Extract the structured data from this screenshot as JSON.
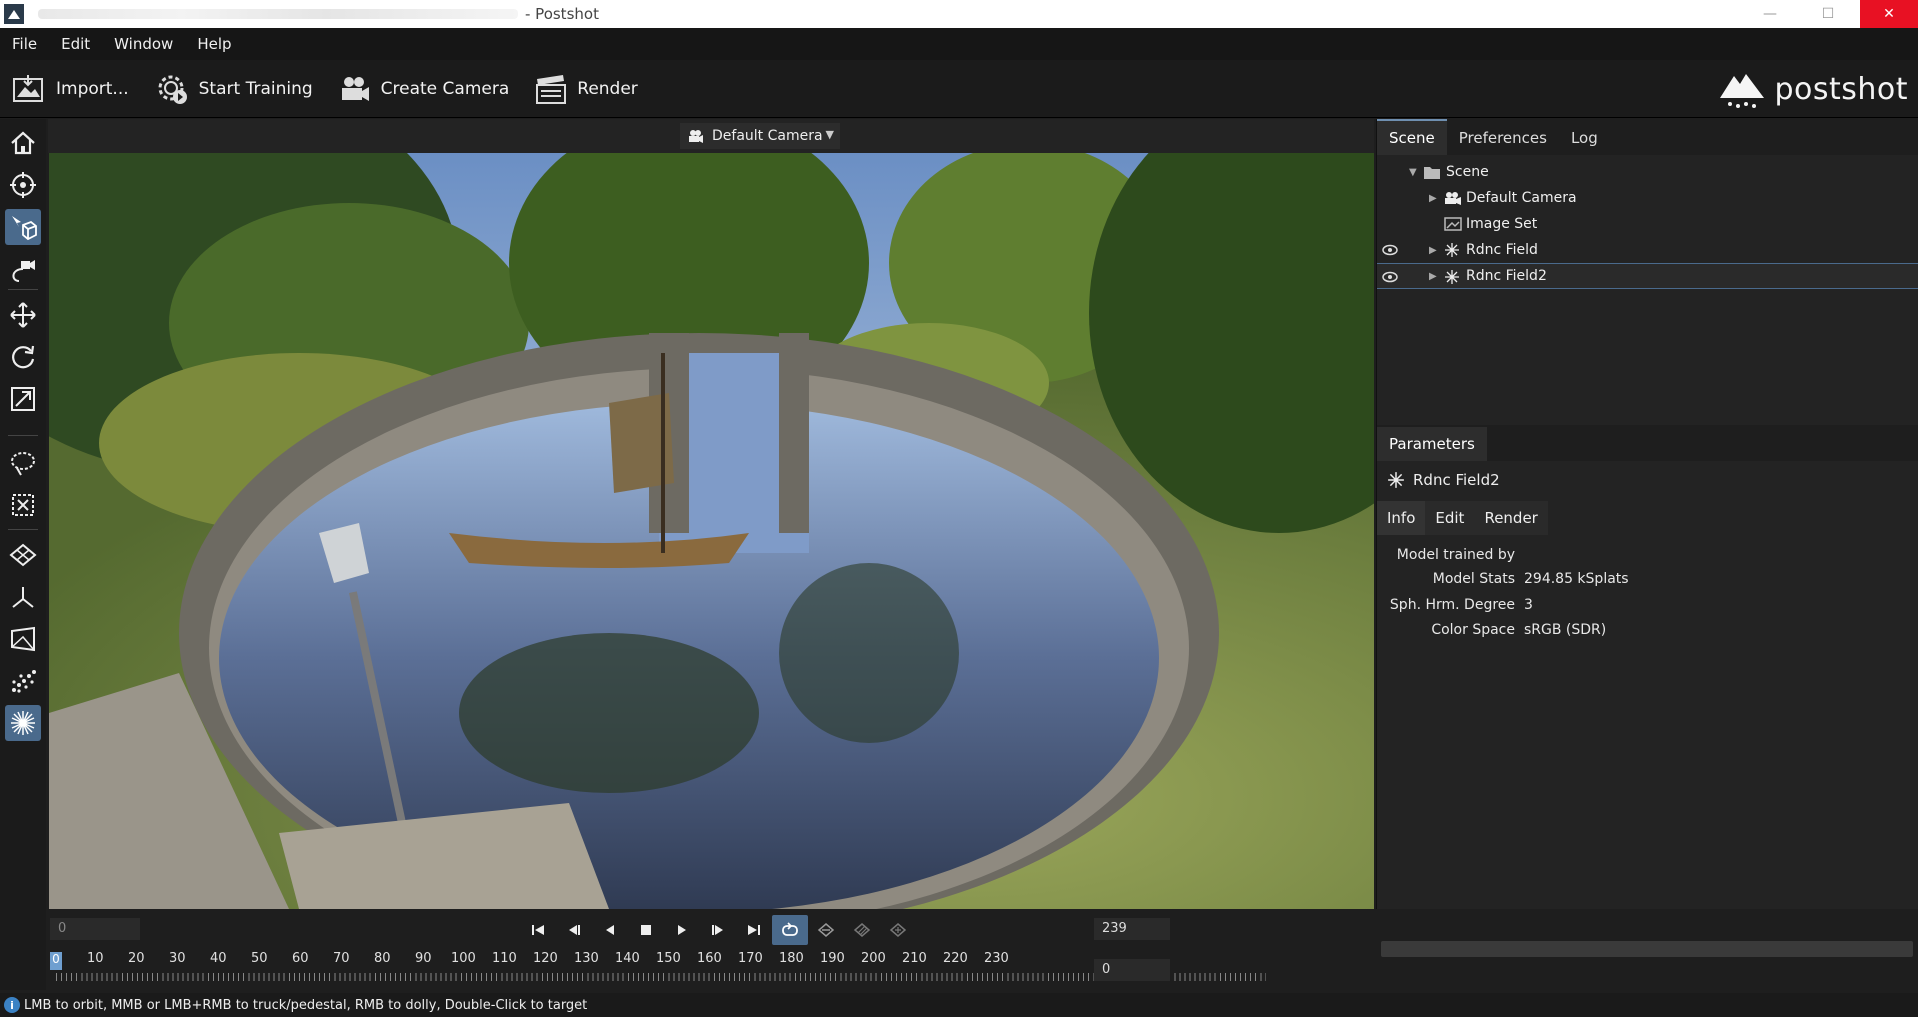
{
  "window": {
    "title": "- Postshot",
    "minimize": "—",
    "maximize": "☐",
    "close": "✕"
  },
  "menu": [
    "File",
    "Edit",
    "Window",
    "Help"
  ],
  "toolbar": {
    "import": "Import...",
    "start_training": "Start Training",
    "create_camera": "Create Camera",
    "render": "Render",
    "logo": "postshot"
  },
  "viewport": {
    "camera": "Default Camera"
  },
  "right_panel": {
    "tabs": [
      "Scene",
      "Preferences",
      "Log"
    ],
    "tree": {
      "root": "Scene",
      "items": [
        "Default Camera",
        "Image Set",
        "Rdnc Field",
        "Rdnc Field2"
      ]
    },
    "parameters": {
      "title": "Parameters",
      "object": "Rdnc Field2",
      "subtabs": [
        "Info",
        "Edit",
        "Render"
      ],
      "fields": [
        {
          "key": "Model trained by",
          "value": ""
        },
        {
          "key": "Model Stats",
          "value": "294.85 kSplats"
        },
        {
          "key": "Sph. Hrm. Degree",
          "value": "3"
        },
        {
          "key": "Color Space",
          "value": "sRGB (SDR)"
        }
      ]
    }
  },
  "timeline": {
    "start_field": "0",
    "end_field": "239",
    "current_field": "0",
    "playhead": "0",
    "ticks": [
      "10",
      "20",
      "30",
      "40",
      "50",
      "60",
      "70",
      "80",
      "90",
      "100",
      "110",
      "120",
      "130",
      "140",
      "150",
      "160",
      "170",
      "180",
      "190",
      "200",
      "210",
      "220",
      "230"
    ]
  },
  "status": "LMB to orbit, MMB or LMB+RMB to truck/pedestal, RMB to dolly, Double-Click to target",
  "colors": {
    "accent": "#4a6a8c",
    "background": "#1e1e1e",
    "info": "#3b82c4"
  }
}
